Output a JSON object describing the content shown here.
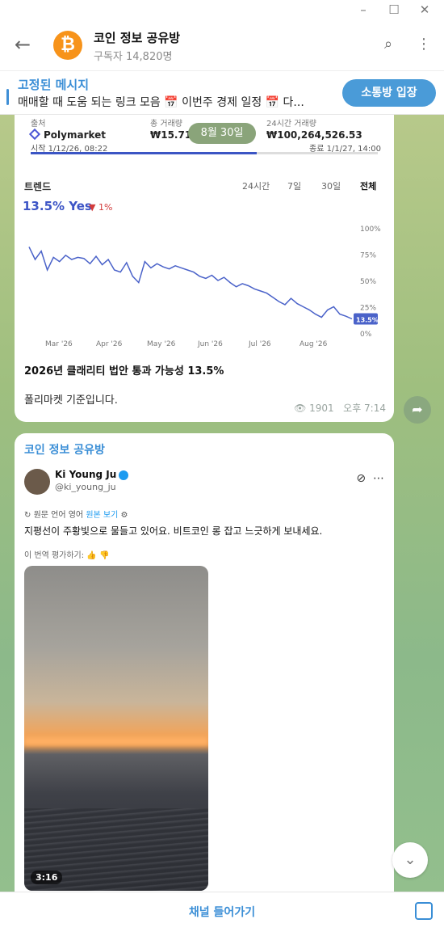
{
  "header": {
    "back_icon": "arrow-left-icon",
    "title": "코인 정보 공유방",
    "subtitle": "구독자 14,820명",
    "avatar_icon": "bitcoin-icon"
  },
  "pinned": {
    "title": "고정된 메시지",
    "text": "매매할 때 도움 되는 링크 모음 📅 이번주 경제 일정 📅 다...",
    "join_button": "소통방 입장"
  },
  "chat": {
    "date_pill": "8월 30일",
    "message1": {
      "market": {
        "source_label": "출처",
        "source": "Polymarket",
        "volume_label": "총 거래량",
        "volume": "₩15.71B",
        "volume_24h_label": "24시간 거래량",
        "volume_24h": "₩100,264,526.53",
        "start": "시작 1/12/26, 08:22",
        "end": "종료 1/1/27, 14:00"
      },
      "trend": {
        "label": "트렌드",
        "tabs": [
          "24시간",
          "7일",
          "30일",
          "전체"
        ],
        "active_tab": "전체",
        "odds": "13.5% Yes",
        "change": "▼ 1%"
      },
      "title": "2026년 클래리티 법안 통과 가능성 13.5%",
      "body": "폴리마켓 기준입니다.",
      "views": "1901",
      "time": "오후 7:14"
    },
    "message2": {
      "channel": "코인 정보 공유방",
      "author_name": "Ki Young Ju",
      "author_handle": "@ki_young_ju",
      "translate_line": "원문 언어 영어",
      "translate_link": "원본 보기",
      "tweet_text": "지평선이 주황빛으로 물들고 있어요. 비트코인 롱 잡고 느긋하게 보내세요.",
      "rate_line": "이 번역 평가하기:",
      "video_duration": "3:16"
    }
  },
  "bottom": {
    "join_channel": "채널 들어가기"
  },
  "chart_data": {
    "type": "line",
    "title": "",
    "xlabel": "",
    "ylabel": "",
    "x_ticks": [
      "Mar '26",
      "Apr '26",
      "May '26",
      "Jun '26",
      "Jul '26",
      "Aug '26"
    ],
    "y_ticks": [
      "100%",
      "75%",
      "50%",
      "25%",
      "0%"
    ],
    "ylim": [
      0,
      100
    ],
    "series": [
      {
        "values": [
          82,
          70,
          78,
          60,
          72,
          68,
          74,
          70,
          72,
          71,
          66,
          73,
          65,
          70,
          60,
          58,
          67,
          54,
          48,
          68,
          62,
          66,
          63,
          61,
          64,
          62,
          60,
          58,
          54,
          52,
          55,
          50,
          53,
          48,
          44,
          47,
          45,
          42,
          40,
          38,
          34,
          30,
          27,
          33,
          28,
          25,
          22,
          18,
          15,
          22,
          25,
          18,
          16,
          13.5
        ]
      }
    ],
    "last_value_label": "13.5%",
    "color": "#4a62c9"
  }
}
